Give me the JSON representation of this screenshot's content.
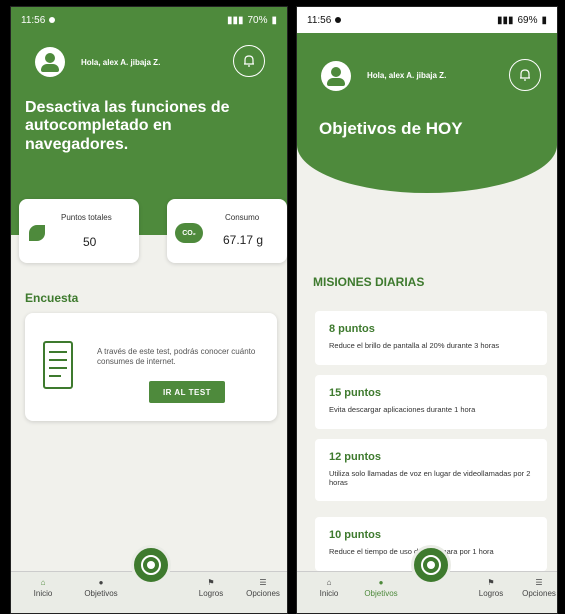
{
  "left": {
    "status": {
      "time": "11:56",
      "battery": "70%"
    },
    "greeting": "Hola, alex A. jibaja Z.",
    "tip": "Desactiva las funciones de autocompletado en navegadores.",
    "points_card": {
      "label": "Puntos totales",
      "value": "50"
    },
    "consumption_card": {
      "label": "Consumo",
      "value": "67.17 g",
      "icon_text": "CO₂"
    },
    "survey": {
      "section_title": "Encuesta",
      "text": "A través de este test, podrás conocer cuánto consumes de internet.",
      "button": "IR AL TEST"
    },
    "nav": {
      "home": "Inicio",
      "goals": "Objetivos",
      "achievements": "Logros",
      "options": "Opciones"
    }
  },
  "right": {
    "status": {
      "time": "11:56",
      "battery": "69%"
    },
    "greeting": "Hola, alex A. jibaja Z.",
    "title": "Objetivos de HOY",
    "section_title": "MISIONES DIARIAS",
    "missions": [
      {
        "points": "8 puntos",
        "desc": "Reduce el brillo de pantalla al 20% durante 3 horas"
      },
      {
        "points": "15 puntos",
        "desc": "Evita descargar aplicaciones durante 1 hora"
      },
      {
        "points": "12 puntos",
        "desc": "Utiliza solo llamadas de voz en lugar de videollamadas por 2 horas"
      },
      {
        "points": "10 puntos",
        "desc": "Reduce el tiempo de uso de la cámara por 1 hora"
      }
    ],
    "nav": {
      "home": "Inicio",
      "goals": "Objetivos",
      "achievements": "Logros",
      "options": "Opciones"
    }
  },
  "colors": {
    "primary": "#4e8a3c",
    "dark": "#3e7a2e",
    "background": "#f1f1ec"
  }
}
